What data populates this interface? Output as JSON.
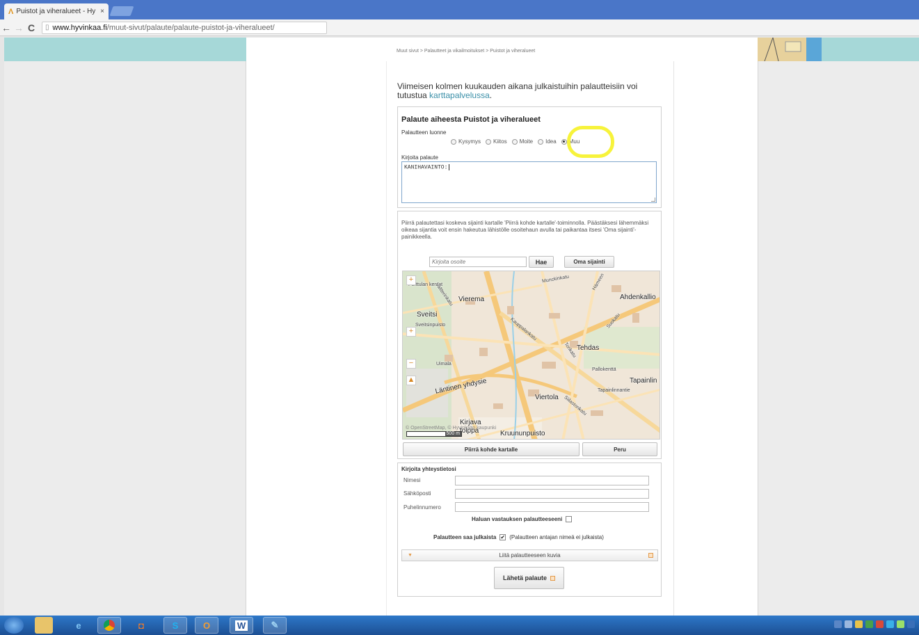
{
  "browser": {
    "tab_title": "Puistot ja viheralueet - Hy",
    "tab_close": "×",
    "favicon": "Λ",
    "url_domain": "www.hyvinkaa.fi",
    "url_path": "/muut-sivut/palaute/palaute-puistot-ja-viheralueet/",
    "back": "←",
    "forward": "→",
    "reload": "C"
  },
  "breadcrumb": "Muut sivut > Palautteet ja vikailmoitukset > Puistot ja viheralueet",
  "intro": {
    "text": "Viimeisen kolmen kuukauden aikana julkaistuihin palautteisiin voi tutustua ",
    "link": "karttapalvelussa",
    "end": "."
  },
  "form": {
    "title": "Palaute aiheesta Puistot ja viheralueet",
    "nature_label": "Palautteen luonne",
    "options": [
      "Kysymys",
      "Kiitos",
      "Moite",
      "Idea",
      "Muu"
    ],
    "selected": "Muu",
    "feedback_label": "Kirjoita palaute",
    "feedback_value": "KANIHAVAINTO:"
  },
  "map_section": {
    "instructions": "Piirrä palautettasi koskeva sijainti kartalle 'Piirrä kohde kartalle'-toiminnolla. Päästäksesi lähemmäksi oikeaa sijantia voit ensin hakeutua lähistölle osoitehaun avulla tai paikantaa itsesi 'Oma sijainti'-painikkeella.",
    "address_placeholder": "Kirjoita osoite",
    "search_button": "Hae",
    "locate_button": "Oma sijainti",
    "draw_button": "Piirrä kohde kartalle",
    "cancel_button": "Peru",
    "zoom_in": "+",
    "zoom_out": "−",
    "scale": "500 m",
    "attribution": "© OpenStreetMap, © Hyvinkään kaupunki",
    "labels": {
      "vierema": "Vierema",
      "ahdenkallio": "Ahdenkallio",
      "sveitsi": "Sveitsi",
      "tehdas": "Tehdas",
      "tapainlinna": "Tapainlin",
      "lantinen": "Läntinen yhdysie",
      "viertola": "Viertola",
      "kirjava": "Kirjava",
      "tolppa": "tolppa",
      "kruununpuisto": "Kruununpuisto",
      "uimala": "Uimala",
      "pallokentta": "Pallokenttä",
      "perttulan": "Perttulan kentat",
      "sveitsinpuisto": "Sveitsinpuisto",
      "kauppalankatu": "Kauppalankatu",
      "valtterinkatu": "Valtterinkatu",
      "munckinkatu": "Munckinkatu",
      "hameenkatu": "Hämeen",
      "tapainlinnantie": "Tapainlinnantie",
      "siilastonkatu": "Siilastonkatu",
      "torikatu": "Torikatu",
      "suokatu": "Suokatu"
    }
  },
  "contact": {
    "title": "Kirjoita yhteystietosi",
    "name_label": "Nimesi",
    "email_label": "Sähköposti",
    "phone_label": "Puhelinnumero",
    "reply_label": "Haluan vastauksen palautteeseeni",
    "publish_label": "Palautteen saa julkaista",
    "publish_note": "(Palautteen antajan nimeä ei julkaista)",
    "attach_label": "Liitä palautteeseen kuvia",
    "send_button": "Lähetä palaute"
  },
  "colors": {
    "accent": "#3a8fa8",
    "highlight": "#f7f33b",
    "band": "#a6d8d8"
  }
}
